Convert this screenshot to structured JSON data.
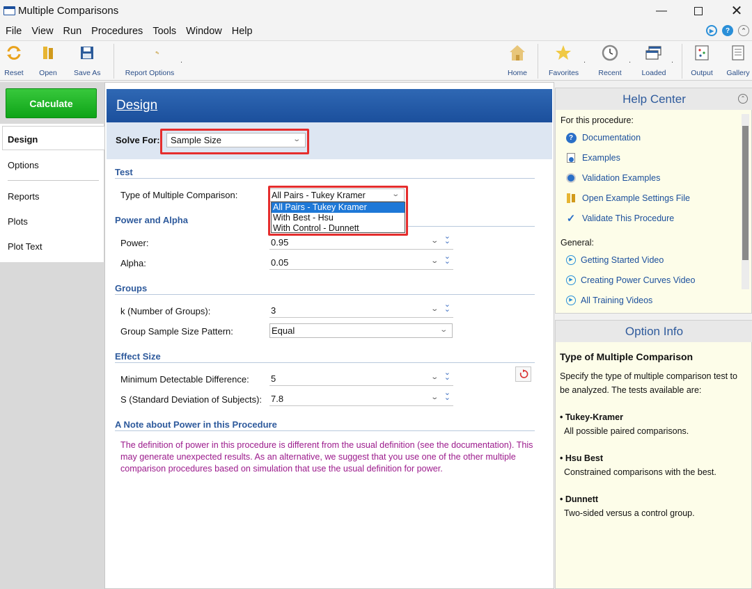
{
  "window": {
    "title": "Multiple Comparisons"
  },
  "menu": [
    "File",
    "View",
    "Run",
    "Procedures",
    "Tools",
    "Window",
    "Help"
  ],
  "toolbar": {
    "reset": "Reset",
    "open": "Open",
    "save_as": "Save As",
    "report_options": "Report Options",
    "home": "Home",
    "favorites": "Favorites",
    "recent": "Recent",
    "loaded": "Loaded",
    "output": "Output",
    "gallery": "Gallery"
  },
  "leftnav": {
    "calculate": "Calculate",
    "items": [
      "Design",
      "Options",
      "Reports",
      "Plots",
      "Plot Text"
    ]
  },
  "design": {
    "title": "Design",
    "solve_for_label": "Solve For:",
    "solve_for_value": "Sample Size",
    "sections": {
      "test": "Test",
      "power_alpha": "Power and Alpha",
      "groups": "Groups",
      "effect_size": "Effect Size",
      "note": "A Note about Power in this Procedure"
    },
    "fields": {
      "type_label": "Type of Multiple Comparison:",
      "type_value": "All Pairs - Tukey Kramer",
      "type_options": [
        "All Pairs - Tukey Kramer",
        "With Best - Hsu",
        "With Control - Dunnett"
      ],
      "power_label": "Power:",
      "power_value": "0.95",
      "alpha_label": "Alpha:",
      "alpha_value": "0.05",
      "k_label": "k (Number of Groups):",
      "k_value": "3",
      "pattern_label": "Group Sample Size Pattern:",
      "pattern_value": "Equal",
      "mdd_label": "Minimum Detectable Difference:",
      "mdd_value": "5",
      "sd_label": "S (Standard Deviation of Subjects):",
      "sd_value": "7.8"
    },
    "note_text": "The definition of power in this procedure is different from the usual definition (see the documentation). This may generate unexpected results. As an alternative, we suggest that you use one of the other multiple comparison procedures based on simulation that use the usual definition for power."
  },
  "help_center": {
    "title": "Help Center",
    "for_this": "For this procedure:",
    "links1": [
      "Documentation",
      "Examples",
      "Validation Examples",
      "Open Example Settings File",
      "Validate This Procedure"
    ],
    "general": "General:",
    "links2": [
      "Getting Started Video",
      "Creating Power Curves Video",
      "All Training Videos"
    ]
  },
  "option_info": {
    "title": "Option Info",
    "heading": "Type of Multiple Comparison",
    "intro": "Specify the type of multiple comparison test to be analyzed. The tests available are:",
    "items": [
      {
        "name": "• Tukey-Kramer",
        "desc": "All possible paired comparisons."
      },
      {
        "name": "• Hsu Best",
        "desc": "Constrained comparisons with the best."
      },
      {
        "name": "• Dunnett",
        "desc": "Two-sided versus a control group."
      }
    ]
  },
  "colors": {
    "accent_blue": "#1b4f9c",
    "calculate_green": "#14a81d",
    "highlight_red": "#e52d2d",
    "note_purple": "#9c1b8c",
    "selection_blue": "#1e78d7"
  }
}
